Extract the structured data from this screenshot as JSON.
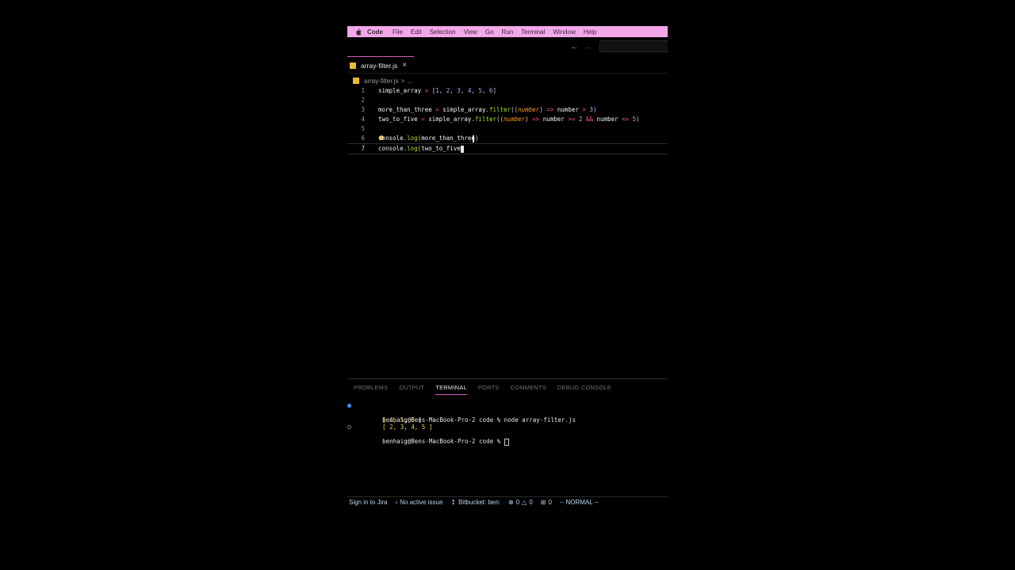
{
  "menubar": {
    "app": "Code",
    "items": [
      "File",
      "Edit",
      "Selection",
      "View",
      "Go",
      "Run",
      "Terminal",
      "Window",
      "Help"
    ]
  },
  "tab": {
    "filename": "array-filter.js",
    "close": "×"
  },
  "breadcrumb": {
    "file": "array-filter.js",
    "sep": ">",
    "more": "..."
  },
  "editor": {
    "lines": [
      {
        "n": "1"
      },
      {
        "n": "2"
      },
      {
        "n": "3"
      },
      {
        "n": "4"
      },
      {
        "n": "5"
      },
      {
        "n": "6"
      },
      {
        "n": "7"
      }
    ],
    "tokens": {
      "l1": [
        "simple_array",
        " = ",
        "[",
        "1",
        ", ",
        "2",
        ", ",
        "3",
        ", ",
        "4",
        ", ",
        "5",
        ", ",
        "6",
        "]"
      ],
      "l3": [
        "more_than_three",
        " = ",
        "simple_array",
        ".",
        "filter",
        "((",
        "number",
        ") ",
        "=>",
        " number ",
        ">",
        " ",
        "3",
        ")"
      ],
      "l4": [
        "two_to_five",
        " = ",
        "simple_array",
        ".",
        "filter",
        "((",
        "number",
        ") ",
        "=>",
        " number ",
        ">=",
        " ",
        "2",
        " ",
        "&&",
        " number ",
        "<=",
        " ",
        "5",
        ")"
      ],
      "l6": [
        "console",
        ".",
        "log",
        "(",
        "more_than_three",
        ")"
      ],
      "l7": [
        "console",
        ".",
        "log",
        "(",
        "two_to_five"
      ]
    }
  },
  "panel": {
    "tabs": [
      "PROBLEMS",
      "OUTPUT",
      "TERMINAL",
      "PORTS",
      "COMMENTS",
      "DEBUG CONSOLE"
    ],
    "active_tab": "TERMINAL",
    "terminal": {
      "prompt1": "benhaig@Bens-MacBook-Pro-2 code % node array-filter.js",
      "out1": "[ 4, 5, 6 ]",
      "out2": "[ 2, 3, 4, 5 ]",
      "prompt2": "benhaig@Bens-MacBook-Pro-2 code % "
    }
  },
  "statusbar": {
    "jira": "Sign in to Jira",
    "issue": "No active issue",
    "bitbucket": "Bitbucket: ben:",
    "errors": "0",
    "warnings": "0",
    "ports": "0",
    "mode": "-- NORMAL --"
  },
  "colors": {
    "menubar": "#f3a6e8",
    "accent": "#d75fb6",
    "js_icon": "#e8bd36",
    "operator": "#ff5c8a",
    "number": "#c79cff",
    "function": "#a6e22e",
    "param": "#fd971f"
  }
}
